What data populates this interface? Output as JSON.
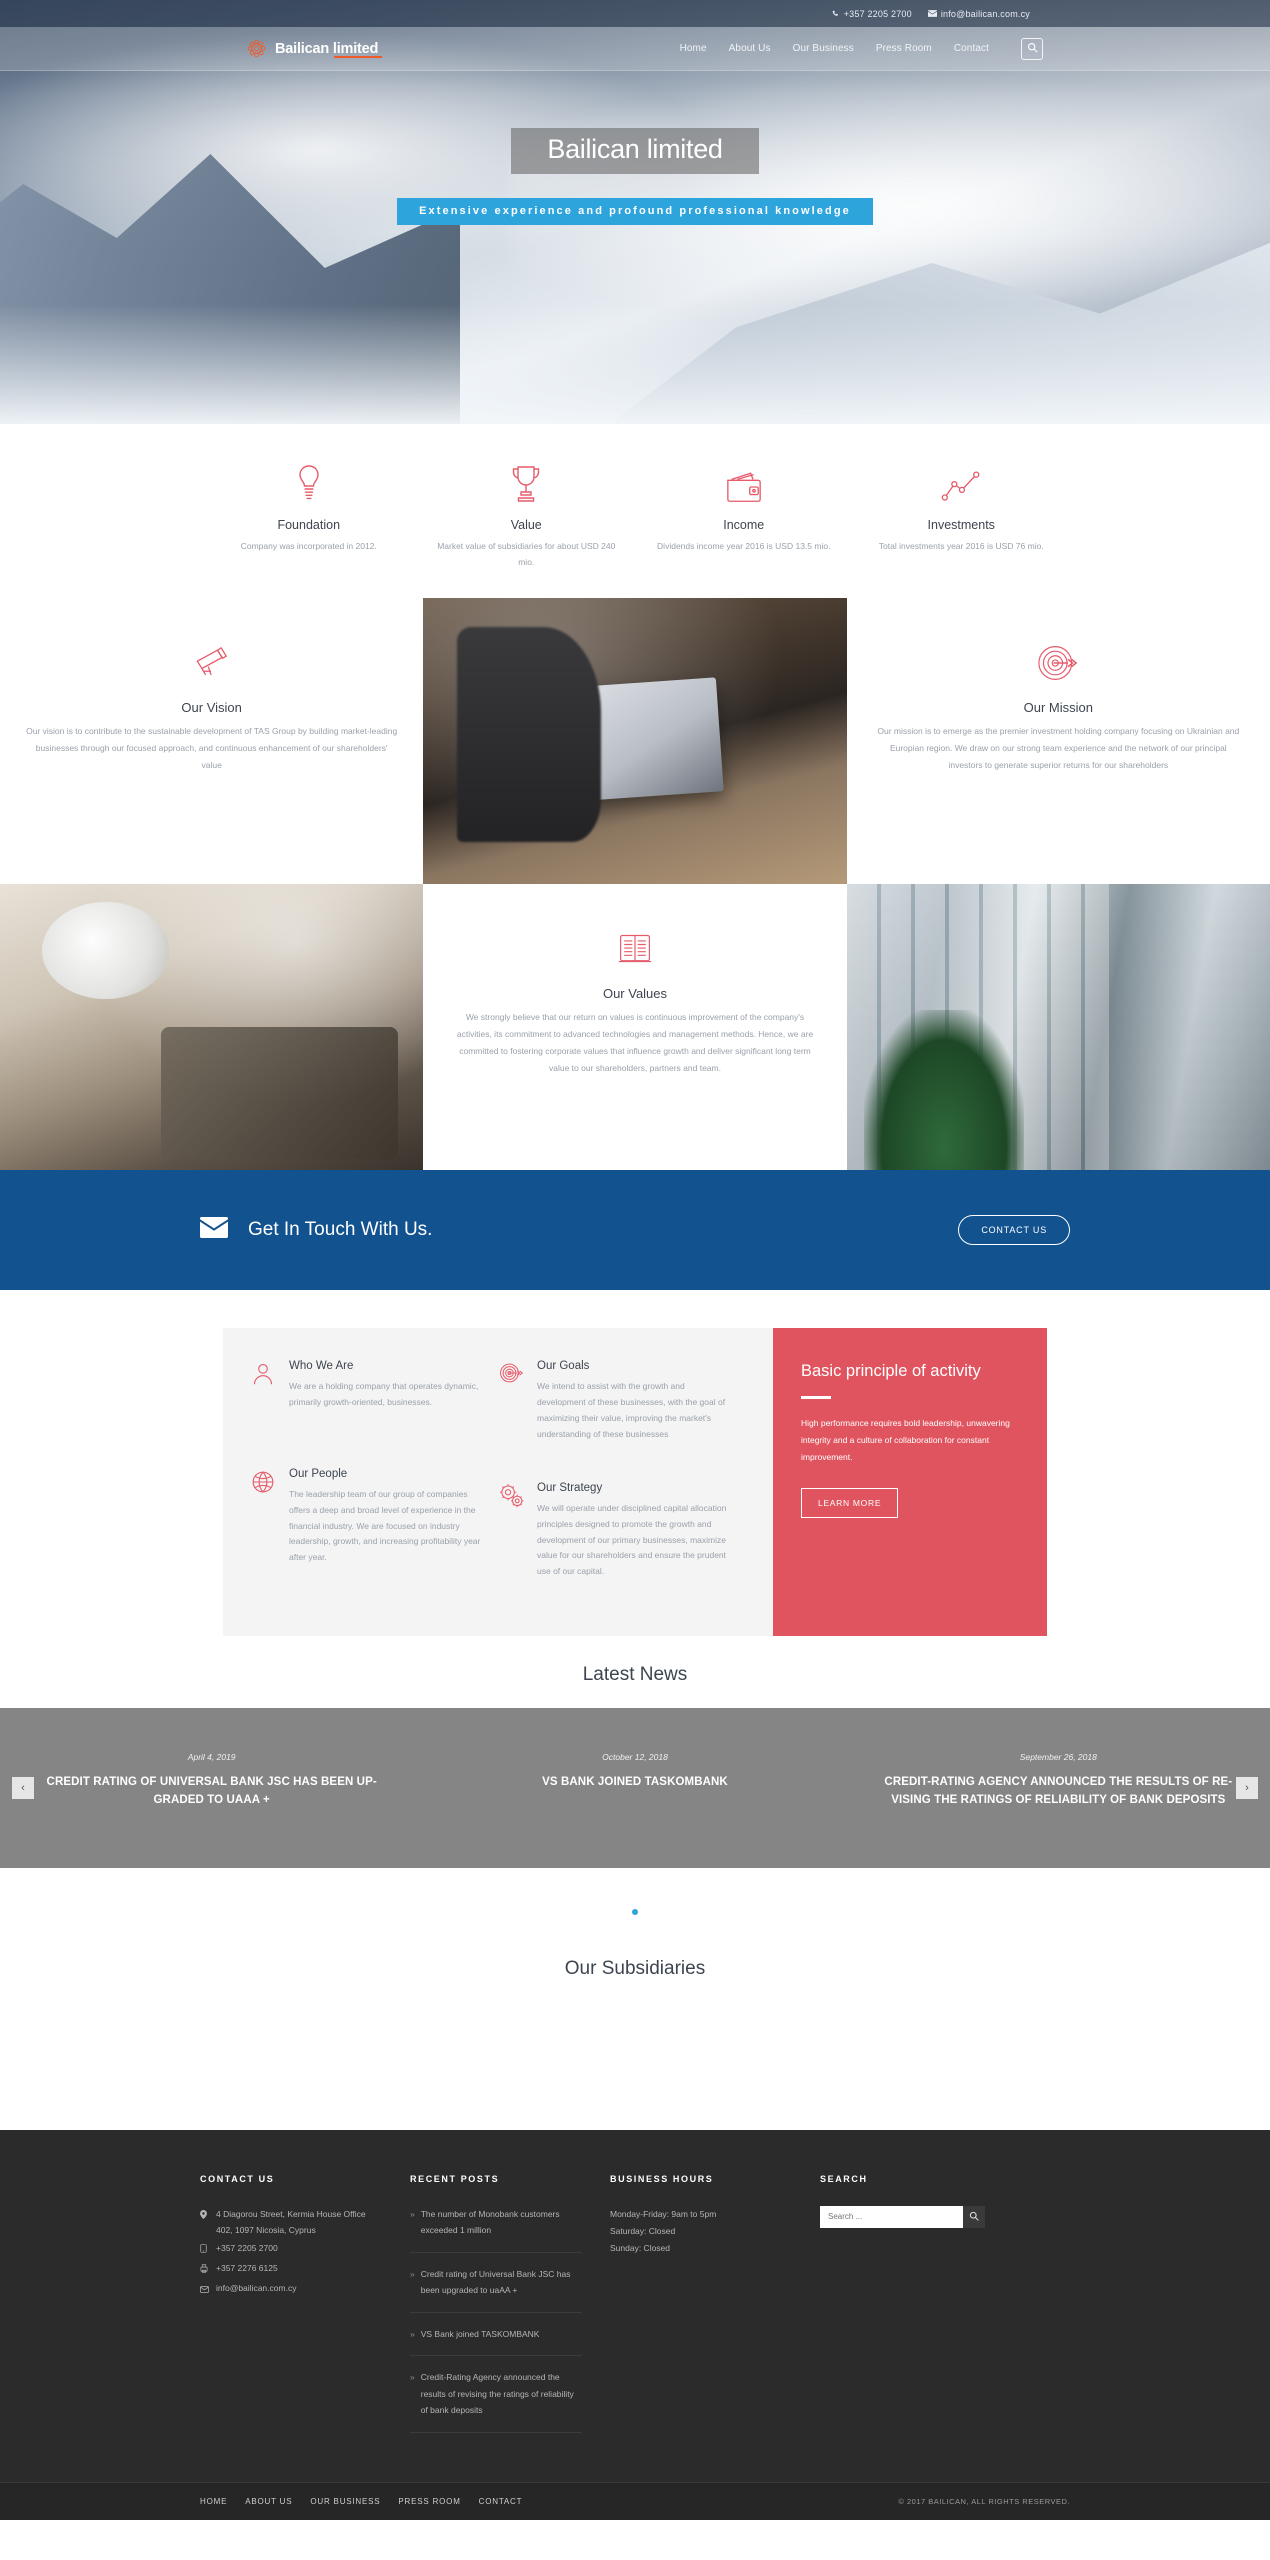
{
  "topbar": {
    "phone": "+357 2205 2700",
    "email": "info@bailican.com.cy",
    "phone_icon": "phone-icon",
    "email_icon": "envelope-icon"
  },
  "header": {
    "logo_text_a": "Bailican",
    "logo_text_b": "limited",
    "logo_icon": "flower-mandala-icon",
    "nav": [
      {
        "label": "Home"
      },
      {
        "label": "About Us"
      },
      {
        "label": "Our Business"
      },
      {
        "label": "Press Room"
      },
      {
        "label": "Contact"
      }
    ],
    "search_icon": "search-icon"
  },
  "hero": {
    "title": "Bailican limited",
    "subtitle": "Extensive experience and profound professional knowledge"
  },
  "stats": [
    {
      "icon": "lightbulb-icon",
      "title": "Foundation",
      "text": "Company was incorporated in 2012."
    },
    {
      "icon": "trophy-icon",
      "title": "Value",
      "text": "Market value of subsidiaries for about USD 240 mio."
    },
    {
      "icon": "wallet-icon",
      "title": "Income",
      "text": "Dividends income year 2016 is USD 13.5 mio."
    },
    {
      "icon": "line-chart-icon",
      "title": "Investments",
      "text": "Total investments year 2016 is USD 76 mio."
    }
  ],
  "vision": {
    "icon": "telescope-icon",
    "title": "Our Vision",
    "text": "Our vision is to contribute to the sustainable development of TAS Group by building market-leading businesses through our focused approach, and continuous enhancement of our shareholders' value"
  },
  "mission": {
    "icon": "target-arrow-icon",
    "title": "Our Mission",
    "text": "Our mission is to emerge as the premier investment holding company focusing on Ukrainian and Europian region. We draw on our strong team experience and the network of our principal investors to generate superior returns for our shareholders"
  },
  "values": {
    "icon": "book-icon",
    "title": "Our Values",
    "text": "We strongly believe that our return on values is continuous improvement of the company's activities, its commitment to advanced technologies and management methods. Hence, we are committed to fostering corporate values that influence growth and deliver significant long term value to our shareholders, partners and team."
  },
  "photos": {
    "laptop": "photo-man-with-laptop",
    "writing": "photo-hand-writing-notes",
    "office": "photo-office-interior"
  },
  "cta": {
    "icon": "envelope-icon",
    "heading": "Get In Touch With Us.",
    "button": "CONTACT US"
  },
  "features": [
    {
      "icon": "person-icon",
      "title": "Who We Are",
      "text": "We are a holding company that operates dynamic, primarily growth-oriented, businesses."
    },
    {
      "icon": "target-arrow-icon",
      "title": "Our Goals",
      "text": "We intend to assist with the growth and development of these businesses, with the goal of maximizing their value, improving the market's understanding of these businesses"
    },
    {
      "icon": "globe-icon",
      "title": "Our People",
      "text": "The leadership team of our group of companies offers a deep and broad level of experience in the financial industry. We are focused on industry leadership, growth, and increasing profitability year after year."
    },
    {
      "icon": "gears-icon",
      "title": "Our Strategy",
      "text": "We will operate under disciplined capital allocation principles designed to promote the growth and development of our primary businesses, maximize value for our shareholders and ensure the prudent use of our capital."
    }
  ],
  "principle": {
    "title": "Basic principle of activity",
    "text": "High performance requires bold leadership, unwavering integrity and a culture of collaboration for constant improvement.",
    "button": "LEARN MORE",
    "accent_color": "#e0545f"
  },
  "news": {
    "heading": "Latest News",
    "prev_icon": "chevron-left-icon",
    "next_icon": "chevron-right-icon",
    "items": [
      {
        "date": "April 4, 2019",
        "title": "CREDIT RATING OF UNIVERSAL BANK JSC HAS BEEN UP-GRADED TO UAAA +"
      },
      {
        "date": "October 12, 2018",
        "title": "VS BANK JOINED TASKOMBANK"
      },
      {
        "date": "September 26, 2018",
        "title": "CREDIT-RATING AGENCY ANNOUNCED THE RESULTS OF RE-VISING THE RATINGS OF RELIABILITY OF BANK DEPOSITS"
      }
    ]
  },
  "subsidiaries": {
    "heading": "Our Subsidiaries"
  },
  "footer": {
    "contact": {
      "heading": "Contact Us",
      "lines": [
        {
          "icon": "map-pin-icon",
          "text": "4 Diagorou Street, Kermia House Office 402, 1097 Nicosia, Cyprus"
        },
        {
          "icon": "phone-icon",
          "text": "+357 2205 2700"
        },
        {
          "icon": "fax-icon",
          "text": "+357 2276 6125"
        },
        {
          "icon": "envelope-icon",
          "text": "info@bailican.com.cy"
        }
      ]
    },
    "recent": {
      "heading": "Recent Posts",
      "items": [
        {
          "text": "The number of Monobank customers exceeded 1 million"
        },
        {
          "text": "Credit rating of Universal Bank JSC has been upgraded to uaAA +"
        },
        {
          "text": "VS Bank joined TASKOMBANK"
        },
        {
          "text": "Credit-Rating Agency announced the results of revising the ratings of reliability of bank deposits"
        }
      ]
    },
    "hours": {
      "heading": "Business Hours",
      "lines": [
        "Monday-Friday: 9am to 5pm",
        "Saturday: Closed",
        "Sunday: Closed"
      ]
    },
    "search": {
      "heading": "Search",
      "placeholder": "Search ...",
      "value": "",
      "icon": "search-icon"
    },
    "bottom_nav": [
      {
        "label": "Home"
      },
      {
        "label": "About Us"
      },
      {
        "label": "Our Business"
      },
      {
        "label": "Press Room"
      },
      {
        "label": "Contact"
      }
    ],
    "copyright": "© 2017 BAILICAN, ALL RIGHTS RESERVED."
  }
}
